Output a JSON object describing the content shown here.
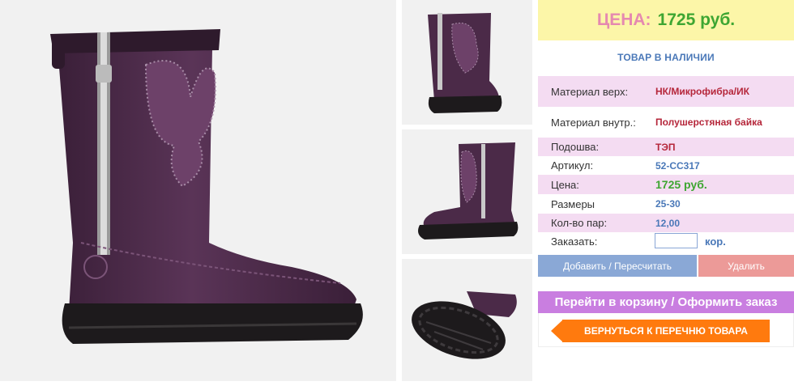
{
  "price": {
    "label": "ЦЕНА:",
    "value": "1725 руб."
  },
  "stock_status": "ТОВАР В НАЛИЧИИ",
  "specs": [
    {
      "label": "Материал верх:",
      "value": "НК/Микрофибра/ИК"
    },
    {
      "label": "Материал внутр.:",
      "value": "Полушерстяная байка"
    },
    {
      "label": "Подошва:",
      "value": "ТЭП"
    },
    {
      "label": "Артикул:",
      "value": "52-CC317"
    },
    {
      "label": "Цена:",
      "value": "1725 руб."
    },
    {
      "label": "Размеры",
      "value": "25-30"
    },
    {
      "label": "Кол-во пар:",
      "value": "12,00"
    }
  ],
  "order": {
    "label": "Заказать:",
    "value": "",
    "unit": "кор."
  },
  "buttons": {
    "add": "Добавить / Пересчитать",
    "delete": "Удалить",
    "cart": "Перейти в корзину / Оформить заказ",
    "back": "ВЕРНУТЬСЯ К ПЕРЕЧНЮ ТОВАРА"
  },
  "colors": {
    "price_bg": "#fcf6a8",
    "price_label": "#e589b0",
    "price_value": "#3ea632",
    "spec_row_highlight": "#f4dcf2",
    "add_button": "#8aa8d6",
    "delete_button": "#ec9a98",
    "cart_button": "#c97ee0",
    "back_button": "#ff7a0e",
    "boot_color": "#4b2a48"
  },
  "images": [
    "boot-side-view",
    "boot-front-view",
    "boot-back-view",
    "boot-sole-view"
  ]
}
